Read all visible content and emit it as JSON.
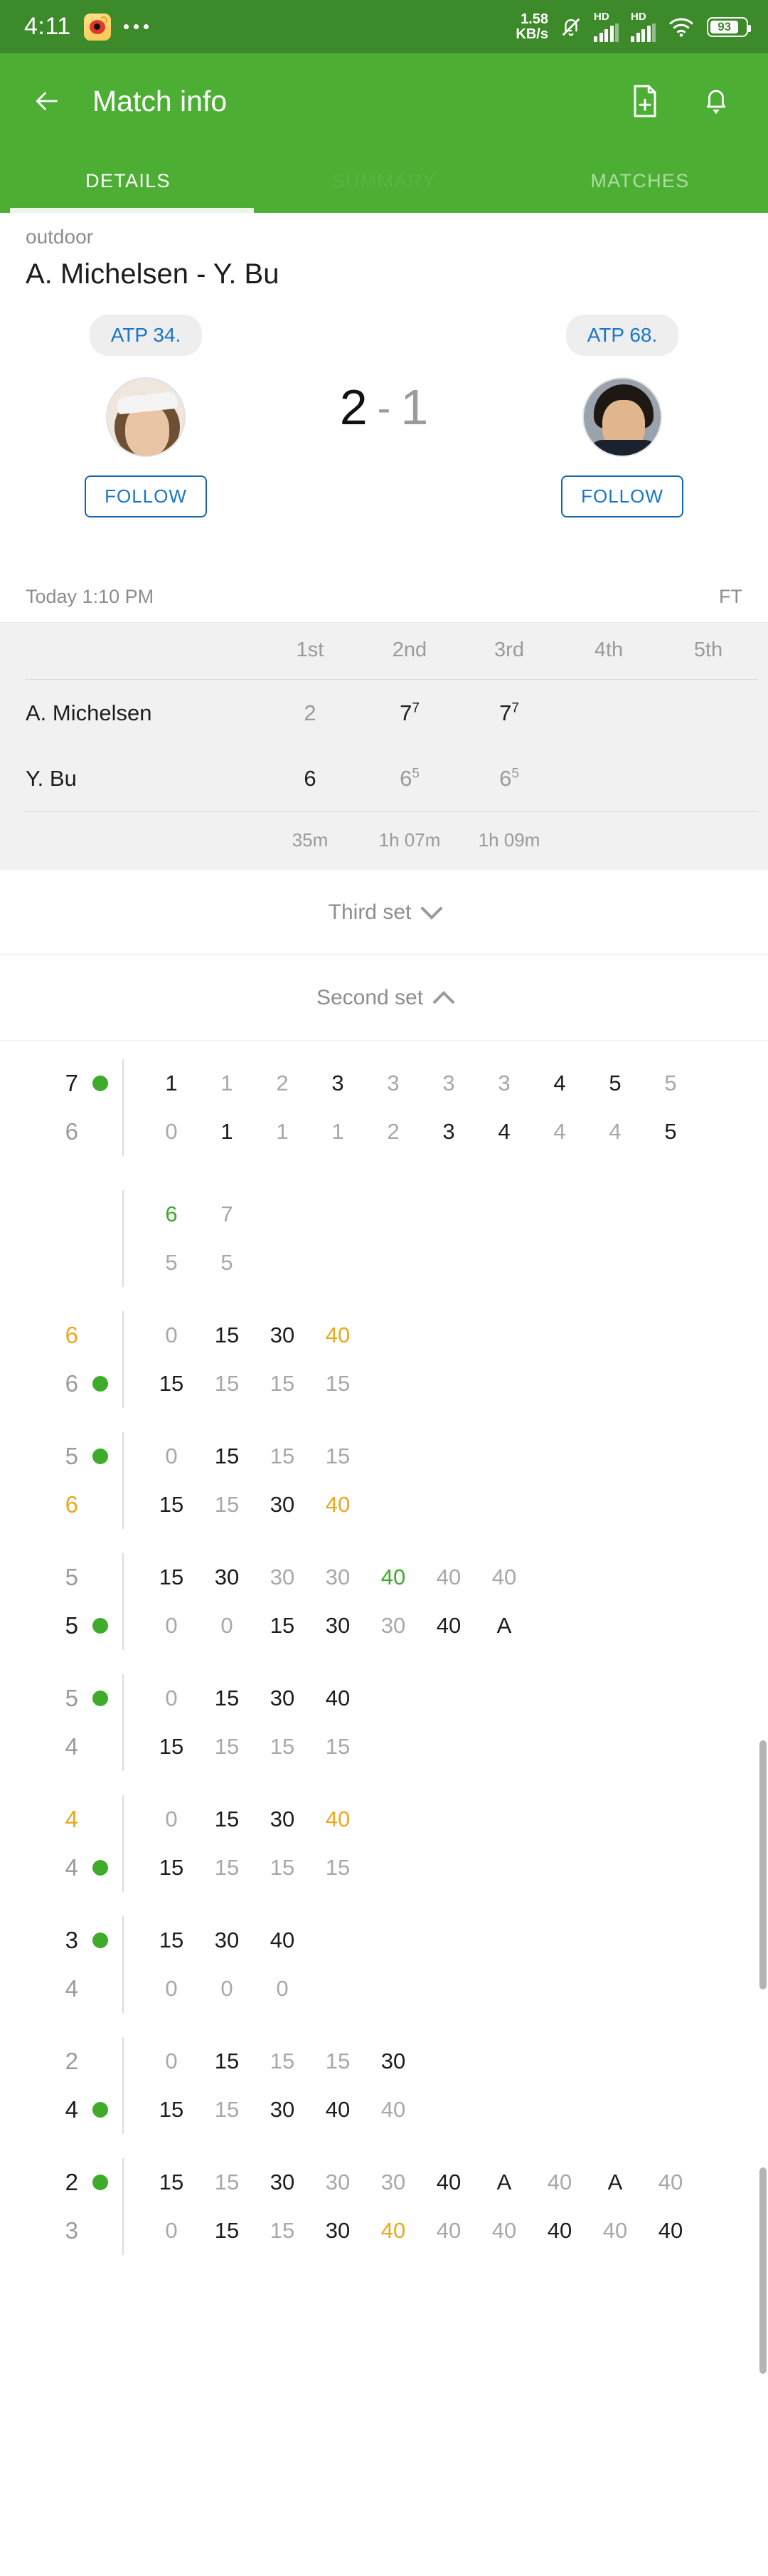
{
  "statusbar": {
    "time": "4:11",
    "app_icon": "weibo-icon",
    "overflow": "more-dots",
    "net_speed_value": "1.58",
    "net_speed_unit": "KB/s",
    "silent_icon": "bell-muted-icon",
    "sim1_label": "HD",
    "sim2_label": "HD",
    "wifi_icon": "wifi-icon",
    "battery_percent": "93"
  },
  "appbar": {
    "back_icon": "back-arrow-icon",
    "title": "Match info",
    "add_note_icon": "document-add-icon",
    "notification_icon": "bell-icon"
  },
  "tabs": [
    {
      "label": "DETAILS",
      "state": "active"
    },
    {
      "label": "SUMMARY",
      "state": "ghost"
    },
    {
      "label": "MATCHES",
      "state": "inactive"
    }
  ],
  "match": {
    "venue": "outdoor",
    "title": "A. Michelsen - Y. Bu",
    "home": {
      "rank": "ATP 34.",
      "follow_label": "FOLLOW",
      "avatar": "player-avatar-michelsen"
    },
    "away": {
      "rank": "ATP 68.",
      "follow_label": "FOLLOW",
      "avatar": "player-avatar-bu"
    },
    "score": {
      "home": "2",
      "separator": "-",
      "away": "1"
    },
    "start_time": "Today 1:10 PM",
    "status": "FT"
  },
  "set_table": {
    "columns": [
      "1st",
      "2nd",
      "3rd",
      "4th",
      "5th"
    ],
    "rows": [
      {
        "name": "A. Michelsen",
        "cells": [
          {
            "main": "2",
            "sup": "",
            "win": false
          },
          {
            "main": "7",
            "sup": "7",
            "win": true
          },
          {
            "main": "7",
            "sup": "7",
            "win": true
          },
          {
            "main": "",
            "sup": "",
            "win": false
          },
          {
            "main": "",
            "sup": "",
            "win": false
          }
        ]
      },
      {
        "name": "Y. Bu",
        "cells": [
          {
            "main": "6",
            "sup": "",
            "win": true
          },
          {
            "main": "6",
            "sup": "5",
            "win": false
          },
          {
            "main": "6",
            "sup": "5",
            "win": false
          },
          {
            "main": "",
            "sup": "",
            "win": false
          },
          {
            "main": "",
            "sup": "",
            "win": false
          }
        ]
      }
    ],
    "durations": [
      "35m",
      "1h 07m",
      "1h 09m",
      "",
      ""
    ]
  },
  "set_sections": [
    {
      "label": "Third set",
      "expanded": false,
      "chevron": "chevron-down-icon"
    },
    {
      "label": "Second set",
      "expanded": true,
      "chevron": "chevron-up-icon"
    }
  ],
  "point_by_point": {
    "games": [
      {
        "kind": "tiebreak_game",
        "top": {
          "games": "7",
          "games_style": "bold",
          "serving": true,
          "points": [
            {
              "v": "1",
              "s": "bold"
            },
            {
              "v": "1",
              "s": "dim"
            },
            {
              "v": "2",
              "s": "dim"
            },
            {
              "v": "3",
              "s": "bold"
            },
            {
              "v": "3",
              "s": "dim"
            },
            {
              "v": "3",
              "s": "dim"
            },
            {
              "v": "3",
              "s": "dim"
            },
            {
              "v": "4",
              "s": "bold"
            },
            {
              "v": "5",
              "s": "bold"
            },
            {
              "v": "5",
              "s": "dim"
            }
          ]
        },
        "bottom": {
          "games": "6",
          "games_style": "dim",
          "serving": false,
          "points": [
            {
              "v": "0",
              "s": "dim"
            },
            {
              "v": "1",
              "s": "bold"
            },
            {
              "v": "1",
              "s": "dim"
            },
            {
              "v": "1",
              "s": "dim"
            },
            {
              "v": "2",
              "s": "dim"
            },
            {
              "v": "3",
              "s": "bold"
            },
            {
              "v": "4",
              "s": "bold"
            },
            {
              "v": "4",
              "s": "dim"
            },
            {
              "v": "4",
              "s": "dim"
            },
            {
              "v": "5",
              "s": "bold"
            }
          ]
        },
        "extra_top": {
          "points": [
            {
              "v": "6",
              "s": "sp"
            },
            {
              "v": "7",
              "s": "dim"
            }
          ]
        },
        "extra_bottom": {
          "points": [
            {
              "v": "5",
              "s": "dim"
            },
            {
              "v": "5",
              "s": "dim"
            }
          ]
        }
      },
      {
        "kind": "game",
        "top": {
          "games": "6",
          "games_style": "bp",
          "serving": false,
          "points": [
            {
              "v": "0",
              "s": "dim"
            },
            {
              "v": "15",
              "s": "bold"
            },
            {
              "v": "30",
              "s": "bold"
            },
            {
              "v": "40",
              "s": "bp"
            }
          ]
        },
        "bottom": {
          "games": "6",
          "games_style": "dim",
          "serving": true,
          "points": [
            {
              "v": "15",
              "s": "bold"
            },
            {
              "v": "15",
              "s": "dim"
            },
            {
              "v": "15",
              "s": "dim"
            },
            {
              "v": "15",
              "s": "dim"
            }
          ]
        }
      },
      {
        "kind": "game",
        "top": {
          "games": "5",
          "games_style": "dim",
          "serving": true,
          "points": [
            {
              "v": "0",
              "s": "dim"
            },
            {
              "v": "15",
              "s": "bold"
            },
            {
              "v": "15",
              "s": "dim"
            },
            {
              "v": "15",
              "s": "dim"
            }
          ]
        },
        "bottom": {
          "games": "6",
          "games_style": "bp",
          "serving": false,
          "points": [
            {
              "v": "15",
              "s": "bold"
            },
            {
              "v": "15",
              "s": "dim"
            },
            {
              "v": "30",
              "s": "bold"
            },
            {
              "v": "40",
              "s": "bp"
            }
          ]
        }
      },
      {
        "kind": "game",
        "top": {
          "games": "5",
          "games_style": "dim",
          "serving": false,
          "points": [
            {
              "v": "15",
              "s": "bold"
            },
            {
              "v": "30",
              "s": "bold"
            },
            {
              "v": "30",
              "s": "dim"
            },
            {
              "v": "30",
              "s": "dim"
            },
            {
              "v": "40",
              "s": "sp"
            },
            {
              "v": "40",
              "s": "dim"
            },
            {
              "v": "40",
              "s": "dim"
            }
          ]
        },
        "bottom": {
          "games": "5",
          "games_style": "bold",
          "serving": true,
          "points": [
            {
              "v": "0",
              "s": "dim"
            },
            {
              "v": "0",
              "s": "dim"
            },
            {
              "v": "15",
              "s": "bold"
            },
            {
              "v": "30",
              "s": "bold"
            },
            {
              "v": "30",
              "s": "dim"
            },
            {
              "v": "40",
              "s": "bold"
            },
            {
              "v": "A",
              "s": "bold"
            }
          ]
        }
      },
      {
        "kind": "game",
        "top": {
          "games": "5",
          "games_style": "dim",
          "serving": true,
          "points": [
            {
              "v": "0",
              "s": "dim"
            },
            {
              "v": "15",
              "s": "bold"
            },
            {
              "v": "30",
              "s": "bold"
            },
            {
              "v": "40",
              "s": "bold"
            }
          ]
        },
        "bottom": {
          "games": "4",
          "games_style": "dim",
          "serving": false,
          "points": [
            {
              "v": "15",
              "s": "bold"
            },
            {
              "v": "15",
              "s": "dim"
            },
            {
              "v": "15",
              "s": "dim"
            },
            {
              "v": "15",
              "s": "dim"
            }
          ]
        }
      },
      {
        "kind": "game",
        "top": {
          "games": "4",
          "games_style": "bp",
          "serving": false,
          "points": [
            {
              "v": "0",
              "s": "dim"
            },
            {
              "v": "15",
              "s": "bold"
            },
            {
              "v": "30",
              "s": "bold"
            },
            {
              "v": "40",
              "s": "bp"
            }
          ]
        },
        "bottom": {
          "games": "4",
          "games_style": "dim",
          "serving": true,
          "points": [
            {
              "v": "15",
              "s": "bold"
            },
            {
              "v": "15",
              "s": "dim"
            },
            {
              "v": "15",
              "s": "dim"
            },
            {
              "v": "15",
              "s": "dim"
            }
          ]
        }
      },
      {
        "kind": "game",
        "top": {
          "games": "3",
          "games_style": "bold",
          "serving": true,
          "points": [
            {
              "v": "15",
              "s": "bold"
            },
            {
              "v": "30",
              "s": "bold"
            },
            {
              "v": "40",
              "s": "bold"
            }
          ]
        },
        "bottom": {
          "games": "4",
          "games_style": "dim",
          "serving": false,
          "points": [
            {
              "v": "0",
              "s": "dim"
            },
            {
              "v": "0",
              "s": "dim"
            },
            {
              "v": "0",
              "s": "dim"
            }
          ]
        }
      },
      {
        "kind": "game",
        "top": {
          "games": "2",
          "games_style": "dim",
          "serving": false,
          "points": [
            {
              "v": "0",
              "s": "dim"
            },
            {
              "v": "15",
              "s": "bold"
            },
            {
              "v": "15",
              "s": "dim"
            },
            {
              "v": "15",
              "s": "dim"
            },
            {
              "v": "30",
              "s": "bold"
            }
          ]
        },
        "bottom": {
          "games": "4",
          "games_style": "bold",
          "serving": true,
          "points": [
            {
              "v": "15",
              "s": "bold"
            },
            {
              "v": "15",
              "s": "dim"
            },
            {
              "v": "30",
              "s": "bold"
            },
            {
              "v": "40",
              "s": "bold"
            },
            {
              "v": "40",
              "s": "dim"
            }
          ]
        }
      },
      {
        "kind": "game",
        "top": {
          "games": "2",
          "games_style": "bold",
          "serving": true,
          "points": [
            {
              "v": "15",
              "s": "bold"
            },
            {
              "v": "15",
              "s": "dim"
            },
            {
              "v": "30",
              "s": "bold"
            },
            {
              "v": "30",
              "s": "dim"
            },
            {
              "v": "30",
              "s": "dim"
            },
            {
              "v": "40",
              "s": "bold"
            },
            {
              "v": "A",
              "s": "bold"
            },
            {
              "v": "40",
              "s": "dim"
            },
            {
              "v": "A",
              "s": "bold"
            },
            {
              "v": "40",
              "s": "dim"
            }
          ]
        },
        "bottom": {
          "games": "3",
          "games_style": "dim",
          "serving": false,
          "points": [
            {
              "v": "0",
              "s": "dim"
            },
            {
              "v": "15",
              "s": "bold"
            },
            {
              "v": "15",
              "s": "dim"
            },
            {
              "v": "30",
              "s": "bold"
            },
            {
              "v": "40",
              "s": "bp"
            },
            {
              "v": "40",
              "s": "dim"
            },
            {
              "v": "40",
              "s": "dim"
            },
            {
              "v": "40",
              "s": "bold"
            },
            {
              "v": "40",
              "s": "dim"
            },
            {
              "v": "40",
              "s": "bold"
            }
          ]
        }
      }
    ]
  },
  "colors": {
    "status_bar_green": "#3d8a2b",
    "app_bar_green": "#4caf33",
    "serve_dot_green": "#3eab2b",
    "break_point_orange": "#eaa81e",
    "set_point_green": "#3eab2b",
    "link_blue": "#1976c8"
  }
}
